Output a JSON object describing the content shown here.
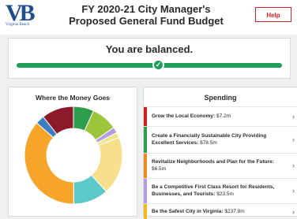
{
  "header": {
    "logo_text": "VB",
    "logo_subtitle": "Virginia Beach",
    "title_line1": "FY 2020-21 City Manager's",
    "title_line2": "Proposed General Fund Budget",
    "help_label": "Help"
  },
  "balance": {
    "message": "You are balanced.",
    "check_icon": "✓"
  },
  "where": {
    "title": "Where the Money Goes"
  },
  "spending": {
    "title": "Spending",
    "items": [
      {
        "label": "Grow the Local Economy:",
        "amount": "$7.2m",
        "color": "#d32027"
      },
      {
        "label": "Create a Financially Sustainable City Providing Excellent Services:",
        "amount": "$78.5m",
        "color": "#2e9e4d"
      },
      {
        "label": "Revitalize Neighborhoods and Plan for the Future:",
        "amount": "$6.5m",
        "color": "#f08a1c"
      },
      {
        "label": "Be a Competitive First Class Resort for Residents, Businesses, and Tourists:",
        "amount": "$23.5m",
        "color": "#b79ae0"
      },
      {
        "label": "Be the Safest City in Virginia:",
        "amount": "$237.8m",
        "color": "#f0b91c"
      }
    ]
  },
  "chart_data": {
    "type": "pie",
    "title": "Where the Money Goes",
    "values": [
      7.0,
      9.0,
      2.0,
      1.8,
      20.0,
      12.0,
      38.0,
      3.0,
      11.0
    ],
    "colors": [
      "#2e9e4d",
      "#9bc53d",
      "#b79ae0",
      "#f0e48a",
      "#f7df8c",
      "#5cc8c8",
      "#f7a52a",
      "#3a7fc1",
      "#8b1a2b"
    ]
  }
}
